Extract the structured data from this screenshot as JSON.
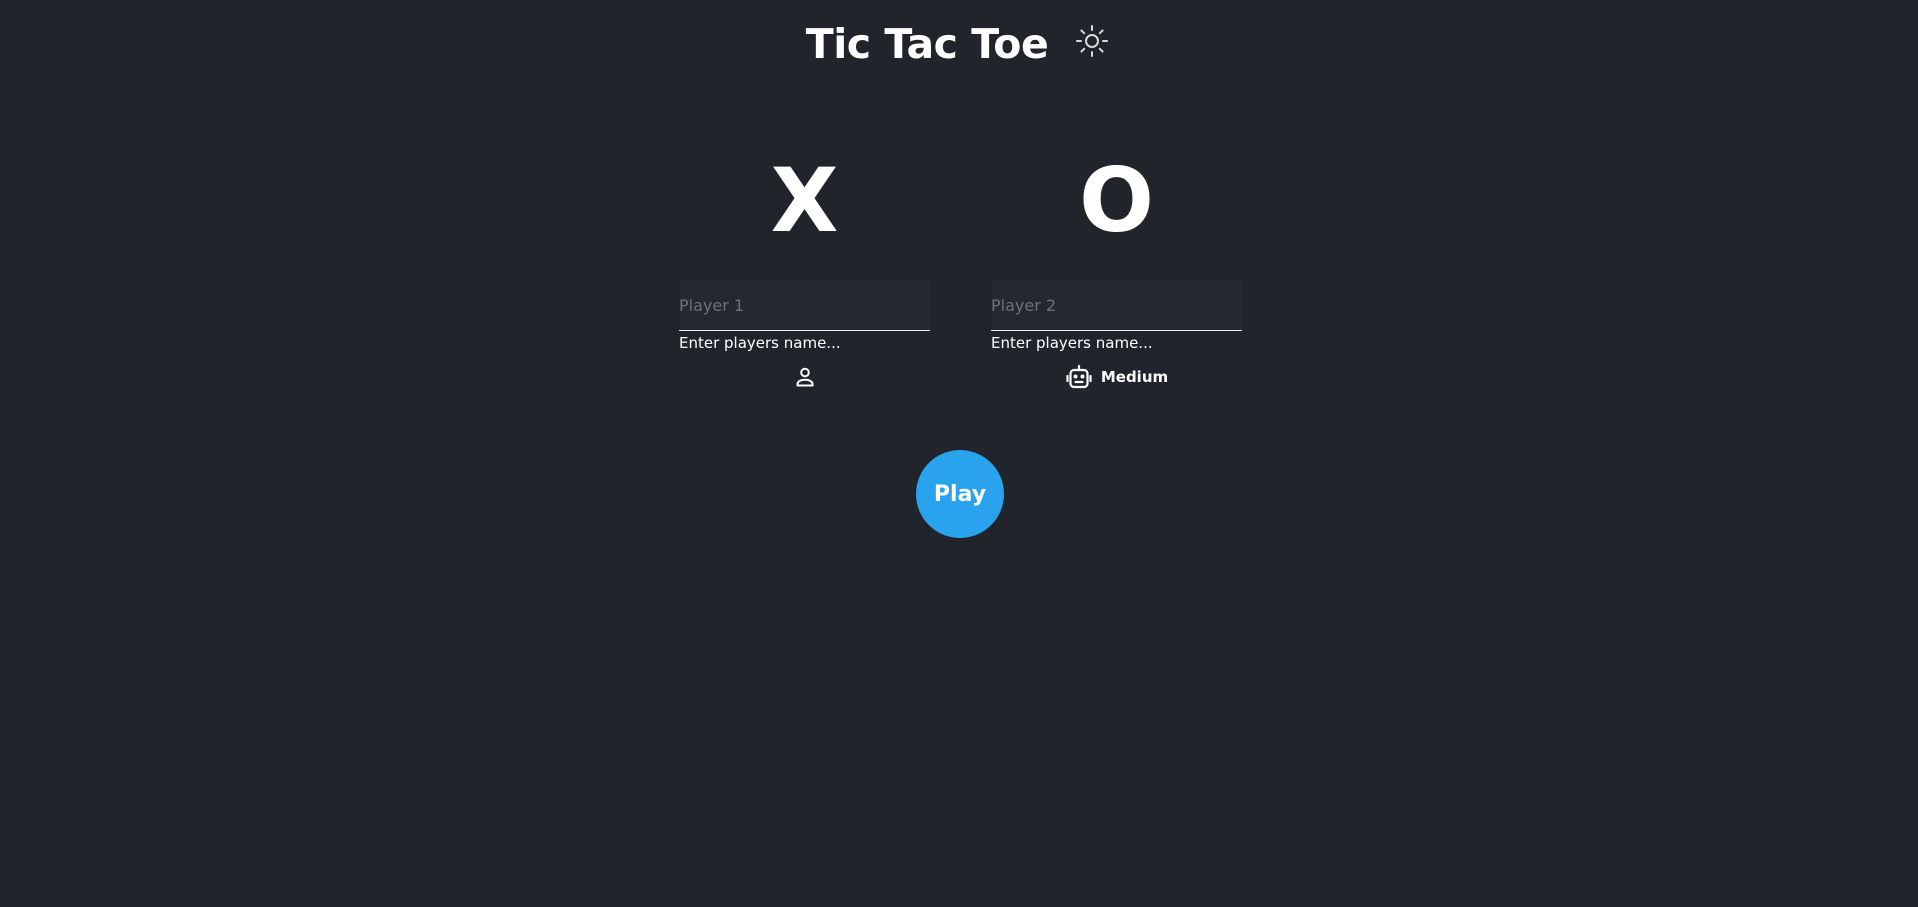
{
  "header": {
    "title": "Tic Tac Toe",
    "theme_icon": "sun-icon"
  },
  "players": [
    {
      "symbol": "X",
      "name_value": "",
      "name_placeholder": "Player 1",
      "helper_text": "Enter players name...",
      "type_icon": "person-icon",
      "type_label": ""
    },
    {
      "symbol": "O",
      "name_value": "",
      "name_placeholder": "Player 2",
      "helper_text": "Enter players name...",
      "type_icon": "robot-icon",
      "type_label": "Medium"
    }
  ],
  "play_button": {
    "label": "Play"
  },
  "colors": {
    "background": "#21242a",
    "text": "#ffffff",
    "accent": "#2aa3ef",
    "input_background": "#25282e",
    "placeholder": "#6e7178"
  }
}
